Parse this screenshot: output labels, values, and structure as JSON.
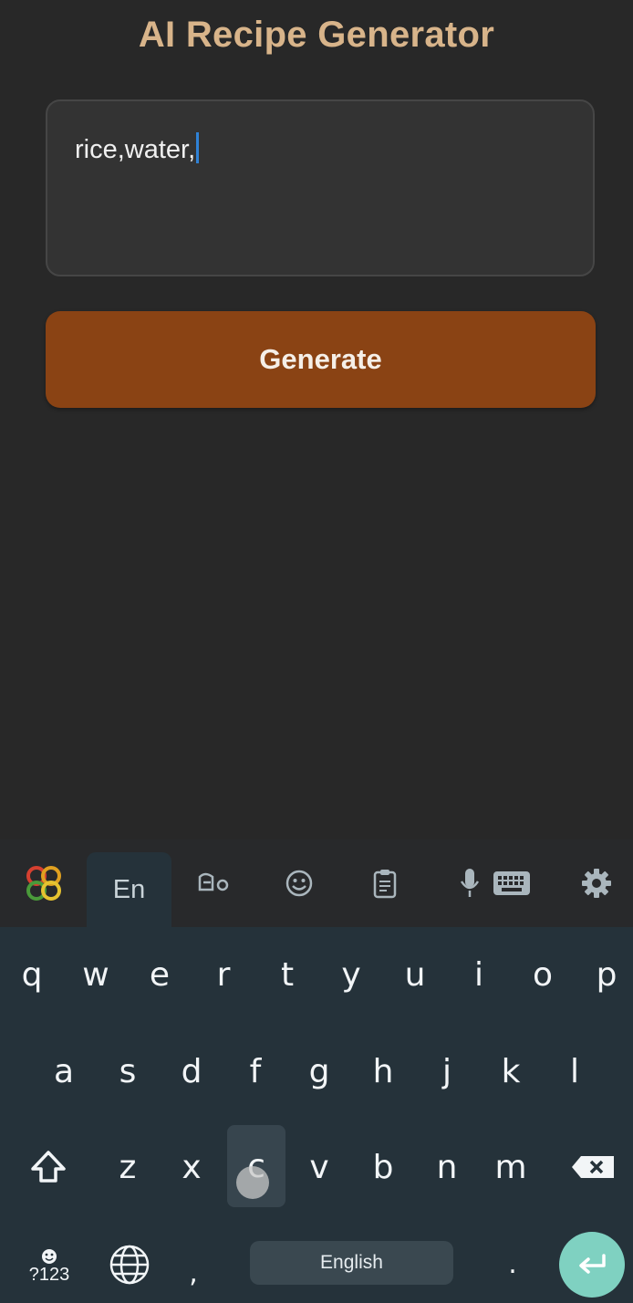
{
  "app": {
    "title": "AI Recipe Generator",
    "ingredients_value": "rice,water,",
    "generate_label": "Generate",
    "colors": {
      "background": "#282828",
      "title": "#d8b48a",
      "button": "#8a4314"
    }
  },
  "keyboard": {
    "toolbar": {
      "lang_tab": "En",
      "icons": [
        "multicolor-logo-icon",
        "sinhala-layout-icon",
        "emoji-icon",
        "clipboard-icon",
        "microphone-icon",
        "keyboard-icon",
        "gear-icon"
      ]
    },
    "rows": [
      [
        "q",
        "w",
        "e",
        "r",
        "t",
        "y",
        "u",
        "i",
        "o",
        "p"
      ],
      [
        "a",
        "s",
        "d",
        "f",
        "g",
        "h",
        "j",
        "k",
        "l"
      ],
      [
        "z",
        "x",
        "c",
        "v",
        "b",
        "n",
        "m"
      ]
    ],
    "pressed_key": "c",
    "symbols_label": "?123",
    "comma": ",",
    "space_label": "English",
    "period": "."
  }
}
